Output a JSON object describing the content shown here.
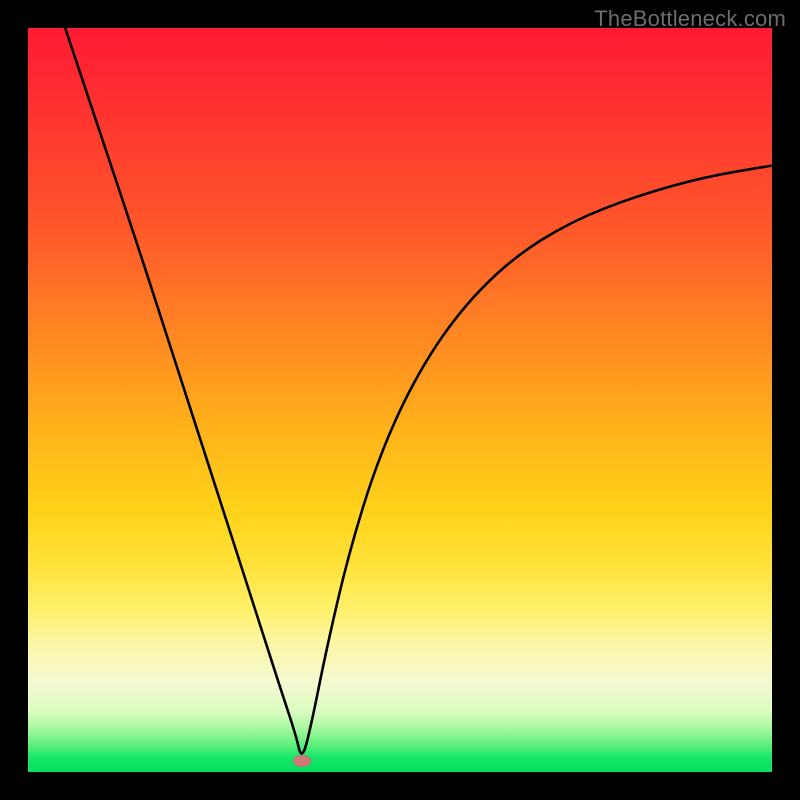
{
  "watermark": "TheBottleneck.com",
  "marker": {
    "x_frac": 0.368,
    "y_frac": 0.985
  },
  "chart_data": {
    "type": "line",
    "title": "",
    "xlabel": "",
    "ylabel": "",
    "xlim": [
      0,
      1
    ],
    "ylim": [
      0,
      1
    ],
    "grid": false,
    "series": [
      {
        "name": "bottleneck-curve",
        "x": [
          0.05,
          0.1,
          0.15,
          0.2,
          0.25,
          0.3,
          0.34,
          0.36,
          0.368,
          0.38,
          0.4,
          0.43,
          0.47,
          0.52,
          0.58,
          0.65,
          0.73,
          0.82,
          0.91,
          1.0
        ],
        "y": [
          1.0,
          0.85,
          0.7,
          0.545,
          0.39,
          0.235,
          0.11,
          0.05,
          0.015,
          0.06,
          0.16,
          0.29,
          0.42,
          0.53,
          0.62,
          0.69,
          0.74,
          0.775,
          0.8,
          0.815
        ]
      }
    ],
    "annotations": [
      {
        "name": "optimal-point",
        "x": 0.368,
        "y": 0.015
      }
    ],
    "background_gradient_stops": [
      {
        "pos": 0.0,
        "color": "#ff1a33"
      },
      {
        "pos": 0.28,
        "color": "#ff5a2a"
      },
      {
        "pos": 0.55,
        "color": "#ffb61a"
      },
      {
        "pos": 0.78,
        "color": "#fff06a"
      },
      {
        "pos": 0.92,
        "color": "#d9fcc0"
      },
      {
        "pos": 1.0,
        "color": "#06df5f"
      }
    ]
  }
}
